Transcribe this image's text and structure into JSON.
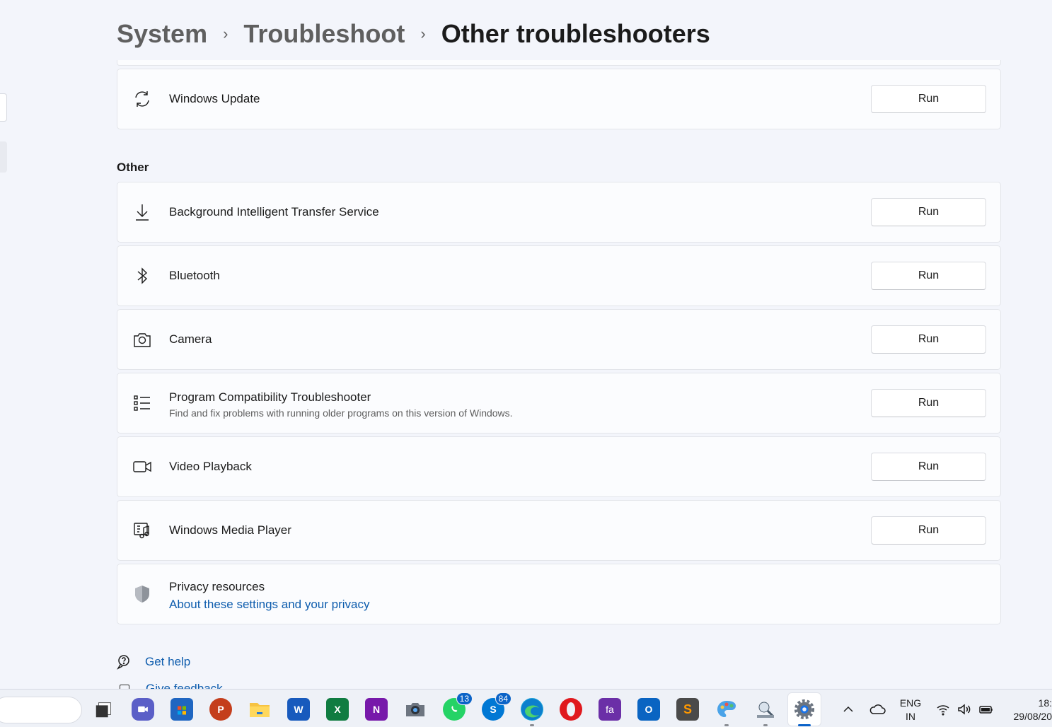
{
  "breadcrumb": {
    "items": [
      "System",
      "Troubleshoot",
      "Other troubleshooters"
    ],
    "separator": "›"
  },
  "top_card": {
    "title": "Windows Update",
    "icon": "refresh-icon",
    "button_label": "Run"
  },
  "section": {
    "heading": "Other"
  },
  "troubleshooters": [
    {
      "title": "Background Intelligent Transfer Service",
      "icon": "download-icon",
      "button_label": "Run"
    },
    {
      "title": "Bluetooth",
      "icon": "bluetooth-icon",
      "button_label": "Run"
    },
    {
      "title": "Camera",
      "icon": "camera-icon",
      "button_label": "Run"
    },
    {
      "title": "Program Compatibility Troubleshooter",
      "description": "Find and fix problems with running older programs on this version of Windows.",
      "icon": "list-icon",
      "button_label": "Run"
    },
    {
      "title": "Video Playback",
      "icon": "video-icon",
      "button_label": "Run"
    },
    {
      "title": "Windows Media Player",
      "icon": "media-player-icon",
      "button_label": "Run"
    }
  ],
  "privacy": {
    "title": "Privacy resources",
    "link": "About these settings and your privacy",
    "icon": "shield-icon"
  },
  "help": {
    "get_help": "Get help",
    "feedback": "Give feedback"
  },
  "taskbar": {
    "apps": [
      {
        "name": "task-view",
        "label": ""
      },
      {
        "name": "teams",
        "label": ""
      },
      {
        "name": "store",
        "label": ""
      },
      {
        "name": "powerpoint",
        "label": "P"
      },
      {
        "name": "file-explorer",
        "label": ""
      },
      {
        "name": "word",
        "label": "W"
      },
      {
        "name": "excel",
        "label": "X"
      },
      {
        "name": "onenote",
        "label": "N"
      },
      {
        "name": "camera",
        "label": ""
      },
      {
        "name": "whatsapp",
        "label": "",
        "badge": "13"
      },
      {
        "name": "skype",
        "label": "S",
        "badge": "84"
      },
      {
        "name": "edge",
        "label": ""
      },
      {
        "name": "opera",
        "label": "O"
      },
      {
        "name": "fa-app",
        "label": "fa"
      },
      {
        "name": "outlook",
        "label": "O"
      },
      {
        "name": "sublime",
        "label": "S"
      },
      {
        "name": "paint",
        "label": ""
      },
      {
        "name": "network-tool",
        "label": ""
      },
      {
        "name": "settings",
        "label": ""
      }
    ],
    "language": {
      "line1": "ENG",
      "line2": "IN"
    },
    "clock": {
      "time": "18:",
      "date": "29/08/20"
    }
  },
  "colors": {
    "accent": "#0d5cad",
    "background": "#f3f5fb",
    "card": "#fbfcfe"
  }
}
